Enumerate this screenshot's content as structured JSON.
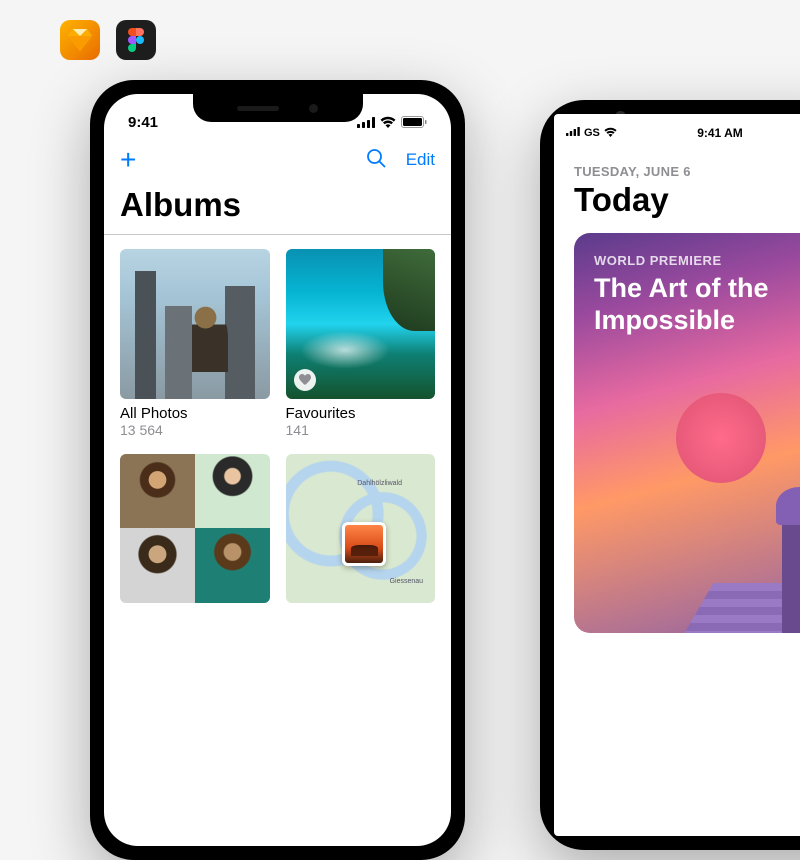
{
  "icons": {
    "sketch": "sketch-app-icon",
    "figma": "figma-app-icon"
  },
  "phone1": {
    "status": {
      "time": "9:41"
    },
    "nav": {
      "add_label": "+",
      "edit_label": "Edit"
    },
    "title": "Albums",
    "albums": [
      {
        "title": "All Photos",
        "count": "13 564"
      },
      {
        "title": "Favourites",
        "count": "141"
      }
    ],
    "map": {
      "label1": "Dahlhölzliwald",
      "label2": "Giessenau"
    }
  },
  "phone2": {
    "status": {
      "carrier": "GS",
      "time": "9:41 AM"
    },
    "date": "TUESDAY, JUNE 6",
    "title": "Today",
    "card": {
      "eyebrow": "WORLD PREMIERE",
      "title": "The Art of the Impossible"
    }
  },
  "colors": {
    "accent": "#007AFF"
  }
}
